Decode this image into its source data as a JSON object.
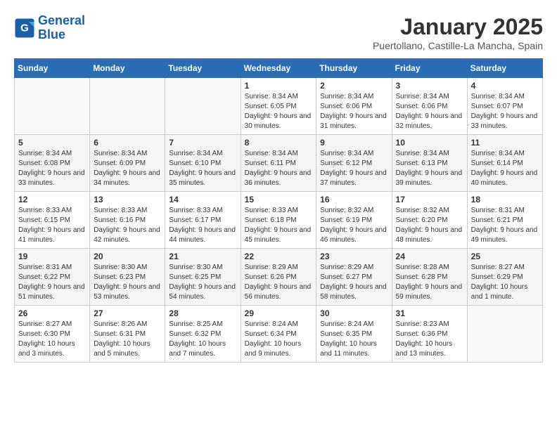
{
  "header": {
    "logo_line1": "General",
    "logo_line2": "Blue",
    "month": "January 2025",
    "location": "Puertollano, Castille-La Mancha, Spain"
  },
  "weekdays": [
    "Sunday",
    "Monday",
    "Tuesday",
    "Wednesday",
    "Thursday",
    "Friday",
    "Saturday"
  ],
  "weeks": [
    [
      {
        "day": "",
        "info": ""
      },
      {
        "day": "",
        "info": ""
      },
      {
        "day": "",
        "info": ""
      },
      {
        "day": "1",
        "info": "Sunrise: 8:34 AM\nSunset: 6:05 PM\nDaylight: 9 hours\nand 30 minutes."
      },
      {
        "day": "2",
        "info": "Sunrise: 8:34 AM\nSunset: 6:06 PM\nDaylight: 9 hours\nand 31 minutes."
      },
      {
        "day": "3",
        "info": "Sunrise: 8:34 AM\nSunset: 6:06 PM\nDaylight: 9 hours\nand 32 minutes."
      },
      {
        "day": "4",
        "info": "Sunrise: 8:34 AM\nSunset: 6:07 PM\nDaylight: 9 hours\nand 33 minutes."
      }
    ],
    [
      {
        "day": "5",
        "info": "Sunrise: 8:34 AM\nSunset: 6:08 PM\nDaylight: 9 hours\nand 33 minutes."
      },
      {
        "day": "6",
        "info": "Sunrise: 8:34 AM\nSunset: 6:09 PM\nDaylight: 9 hours\nand 34 minutes."
      },
      {
        "day": "7",
        "info": "Sunrise: 8:34 AM\nSunset: 6:10 PM\nDaylight: 9 hours\nand 35 minutes."
      },
      {
        "day": "8",
        "info": "Sunrise: 8:34 AM\nSunset: 6:11 PM\nDaylight: 9 hours\nand 36 minutes."
      },
      {
        "day": "9",
        "info": "Sunrise: 8:34 AM\nSunset: 6:12 PM\nDaylight: 9 hours\nand 37 minutes."
      },
      {
        "day": "10",
        "info": "Sunrise: 8:34 AM\nSunset: 6:13 PM\nDaylight: 9 hours\nand 39 minutes."
      },
      {
        "day": "11",
        "info": "Sunrise: 8:34 AM\nSunset: 6:14 PM\nDaylight: 9 hours\nand 40 minutes."
      }
    ],
    [
      {
        "day": "12",
        "info": "Sunrise: 8:33 AM\nSunset: 6:15 PM\nDaylight: 9 hours\nand 41 minutes."
      },
      {
        "day": "13",
        "info": "Sunrise: 8:33 AM\nSunset: 6:16 PM\nDaylight: 9 hours\nand 42 minutes."
      },
      {
        "day": "14",
        "info": "Sunrise: 8:33 AM\nSunset: 6:17 PM\nDaylight: 9 hours\nand 44 minutes."
      },
      {
        "day": "15",
        "info": "Sunrise: 8:33 AM\nSunset: 6:18 PM\nDaylight: 9 hours\nand 45 minutes."
      },
      {
        "day": "16",
        "info": "Sunrise: 8:32 AM\nSunset: 6:19 PM\nDaylight: 9 hours\nand 46 minutes."
      },
      {
        "day": "17",
        "info": "Sunrise: 8:32 AM\nSunset: 6:20 PM\nDaylight: 9 hours\nand 48 minutes."
      },
      {
        "day": "18",
        "info": "Sunrise: 8:31 AM\nSunset: 6:21 PM\nDaylight: 9 hours\nand 49 minutes."
      }
    ],
    [
      {
        "day": "19",
        "info": "Sunrise: 8:31 AM\nSunset: 6:22 PM\nDaylight: 9 hours\nand 51 minutes."
      },
      {
        "day": "20",
        "info": "Sunrise: 8:30 AM\nSunset: 6:23 PM\nDaylight: 9 hours\nand 53 minutes."
      },
      {
        "day": "21",
        "info": "Sunrise: 8:30 AM\nSunset: 6:25 PM\nDaylight: 9 hours\nand 54 minutes."
      },
      {
        "day": "22",
        "info": "Sunrise: 8:29 AM\nSunset: 6:26 PM\nDaylight: 9 hours\nand 56 minutes."
      },
      {
        "day": "23",
        "info": "Sunrise: 8:29 AM\nSunset: 6:27 PM\nDaylight: 9 hours\nand 58 minutes."
      },
      {
        "day": "24",
        "info": "Sunrise: 8:28 AM\nSunset: 6:28 PM\nDaylight: 9 hours\nand 59 minutes."
      },
      {
        "day": "25",
        "info": "Sunrise: 8:27 AM\nSunset: 6:29 PM\nDaylight: 10 hours\nand 1 minute."
      }
    ],
    [
      {
        "day": "26",
        "info": "Sunrise: 8:27 AM\nSunset: 6:30 PM\nDaylight: 10 hours\nand 3 minutes."
      },
      {
        "day": "27",
        "info": "Sunrise: 8:26 AM\nSunset: 6:31 PM\nDaylight: 10 hours\nand 5 minutes."
      },
      {
        "day": "28",
        "info": "Sunrise: 8:25 AM\nSunset: 6:32 PM\nDaylight: 10 hours\nand 7 minutes."
      },
      {
        "day": "29",
        "info": "Sunrise: 8:24 AM\nSunset: 6:34 PM\nDaylight: 10 hours\nand 9 minutes."
      },
      {
        "day": "30",
        "info": "Sunrise: 8:24 AM\nSunset: 6:35 PM\nDaylight: 10 hours\nand 11 minutes."
      },
      {
        "day": "31",
        "info": "Sunrise: 8:23 AM\nSunset: 6:36 PM\nDaylight: 10 hours\nand 13 minutes."
      },
      {
        "day": "",
        "info": ""
      }
    ]
  ]
}
